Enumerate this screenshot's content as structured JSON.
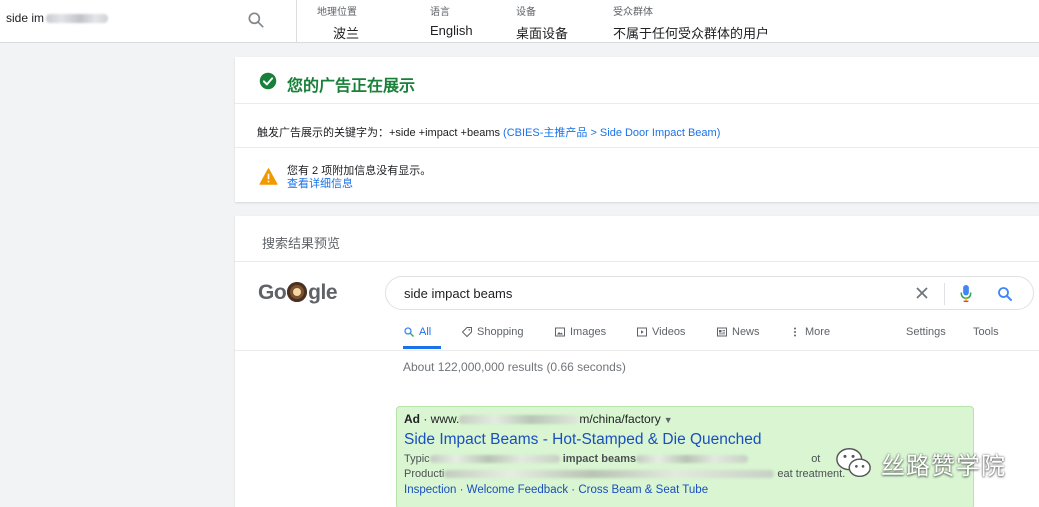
{
  "topbar": {
    "query_prefix": "side im",
    "filters": [
      {
        "label": "地理位置",
        "value": "波兰"
      },
      {
        "label": "语言",
        "value": "English"
      },
      {
        "label": "设备",
        "value": "桌面设备"
      },
      {
        "label": "受众群体",
        "value": "不属于任何受众群体的用户"
      }
    ]
  },
  "status": {
    "title": "您的广告正在展示",
    "keyword_prefix": "触发广告展示的关键字为：+side +impact +beams",
    "keyword_link": "(CBIES-主推产品 > Side Door Impact Beam)",
    "warning_text": "您有 2 项附加信息没有显示。",
    "warning_link": "查看详细信息",
    "colors": {
      "success": "#188038",
      "warning": "#f29900",
      "link": "#1a73e8"
    }
  },
  "preview": {
    "title": "搜索结果预览",
    "logo": {
      "before": "Go",
      "after": "gle"
    },
    "search_query": "side impact beams",
    "tabs": [
      {
        "label": "All",
        "icon": "search-icon"
      },
      {
        "label": "Shopping",
        "icon": "tag-icon"
      },
      {
        "label": "Images",
        "icon": "image-icon"
      },
      {
        "label": "Videos",
        "icon": "play-icon"
      },
      {
        "label": "News",
        "icon": "newspaper-icon"
      },
      {
        "label": "More",
        "icon": "more-vertical-icon"
      }
    ],
    "settings_label": "Settings",
    "tools_label": "Tools",
    "results_count": "About 122,000,000 results (0.66 seconds)",
    "ad": {
      "badge": "Ad",
      "url_prefix": "· www.",
      "url_suffix": "m/china/factory",
      "title": "Side Impact Beams - Hot-Stamped & Die Quenched",
      "desc_line1_start": "Typic",
      "desc_line1_bold": "impact beams",
      "desc_line1_end": "ot",
      "desc_line2_start": "Producti",
      "desc_line2_end": "eat treatment.",
      "sitelinks": [
        "Inspection",
        "Welcome Feedback",
        "Cross Beam & Seat Tube"
      ]
    }
  },
  "watermark": {
    "text": "丝路赞学院"
  }
}
